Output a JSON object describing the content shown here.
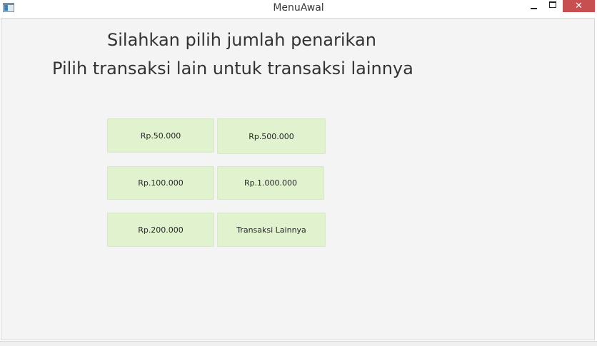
{
  "window": {
    "title": "MenuAwal",
    "close_glyph": "✕"
  },
  "icons": {
    "app": "app-window-icon",
    "minimize": "minimize-icon",
    "maximize": "maximize-icon",
    "close": "close-icon"
  },
  "colors": {
    "button_bg": "#e1f2cf",
    "close_bg": "#c74f50",
    "content_bg": "#f4f4f4"
  },
  "main": {
    "heading_line1": "Silahkan pilih jumlah penarikan",
    "heading_line2": "Pilih transaksi lain untuk transaksi lainnya",
    "buttons": [
      {
        "label": "Rp.50.000"
      },
      {
        "label": "Rp.500.000"
      },
      {
        "label": "Rp.100.000"
      },
      {
        "label": "Rp.1.000.000"
      },
      {
        "label": "Rp.200.000"
      },
      {
        "label": "Transaksi Lainnya"
      }
    ]
  }
}
